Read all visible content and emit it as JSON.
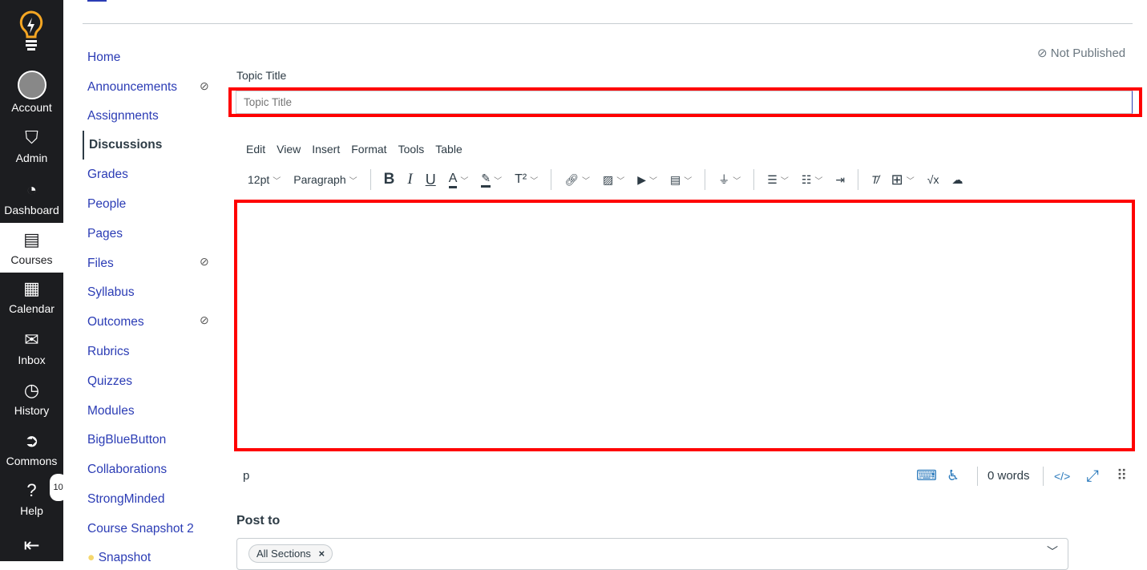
{
  "global_nav": [
    {
      "label": "Account",
      "icon": "avatar-icon"
    },
    {
      "label": "Admin",
      "icon": "shield-icon"
    },
    {
      "label": "Dashboard",
      "icon": "speedometer-icon"
    },
    {
      "label": "Courses",
      "icon": "book-icon",
      "active": true
    },
    {
      "label": "Calendar",
      "icon": "calendar-icon"
    },
    {
      "label": "Inbox",
      "icon": "inbox-icon"
    },
    {
      "label": "History",
      "icon": "clock-icon"
    },
    {
      "label": "Commons",
      "icon": "commons-icon"
    },
    {
      "label": "Help",
      "icon": "help-icon",
      "badge": "10"
    }
  ],
  "course_nav": [
    {
      "label": "Home"
    },
    {
      "label": "Announcements",
      "hidden": true
    },
    {
      "label": "Assignments"
    },
    {
      "label": "Discussions",
      "active": true
    },
    {
      "label": "Grades"
    },
    {
      "label": "People"
    },
    {
      "label": "Pages"
    },
    {
      "label": "Files",
      "hidden": true
    },
    {
      "label": "Syllabus"
    },
    {
      "label": "Outcomes",
      "hidden": true
    },
    {
      "label": "Rubrics"
    },
    {
      "label": "Quizzes"
    },
    {
      "label": "Modules"
    },
    {
      "label": "BigBlueButton"
    },
    {
      "label": "Collaborations"
    },
    {
      "label": "StrongMinded"
    },
    {
      "label": "Course Snapshot 2"
    },
    {
      "label": "Snapshot"
    }
  ],
  "status": "Not Published",
  "topic": {
    "label": "Topic Title",
    "placeholder": "Topic Title",
    "value": ""
  },
  "editor": {
    "menu": [
      "Edit",
      "View",
      "Insert",
      "Format",
      "Tools",
      "Table"
    ],
    "font_size": "12pt",
    "block": "Paragraph",
    "path": "p",
    "word_count": "0 words"
  },
  "post_to": {
    "label": "Post to",
    "chip": "All Sections"
  },
  "colors": {
    "nav_bg": "#1c1d20",
    "link": "#2b3cb5",
    "highlight": "#ff0000",
    "logo": "#f5a623"
  }
}
